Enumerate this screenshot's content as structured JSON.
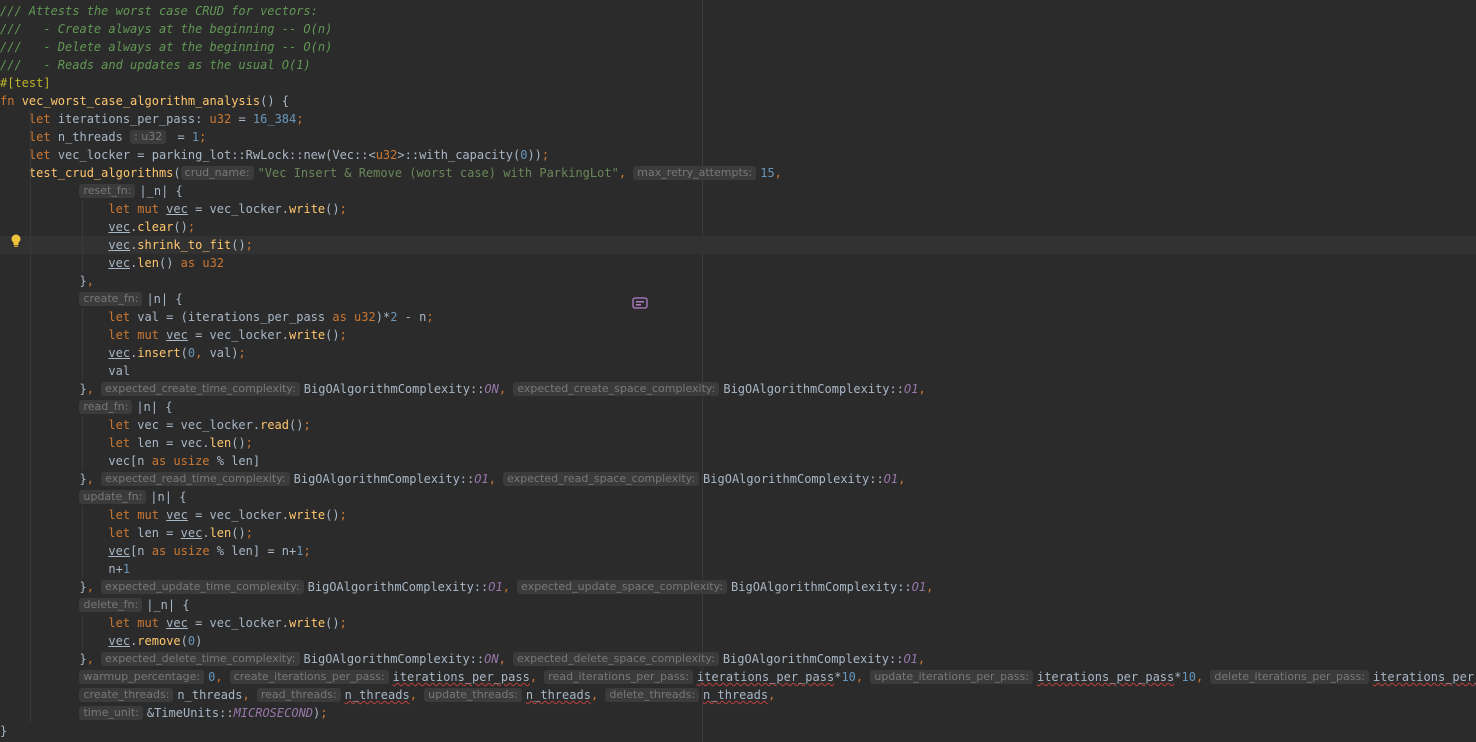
{
  "editor": {
    "lines": [
      [
        [
          "comment",
          "/// Attests the worst case CRUD for vectors:"
        ]
      ],
      [
        [
          "comment",
          "///   - Create always at the beginning -- O(n)"
        ]
      ],
      [
        [
          "comment",
          "///   - Delete always at the beginning -- O(n)"
        ]
      ],
      [
        [
          "comment",
          "///   - Reads and updates as the usual O(1)"
        ]
      ],
      [
        [
          "attr",
          "#[test]"
        ]
      ],
      [
        [
          "kw",
          "fn "
        ],
        [
          "fn",
          "vec_worst_case_algorithm_analysis"
        ],
        [
          "plain",
          "() {"
        ]
      ],
      [
        [
          "plain",
          "    "
        ],
        [
          "kw",
          "let "
        ],
        [
          "plain",
          "iterations_per_pass: "
        ],
        [
          "type",
          "u32"
        ],
        [
          "plain",
          " = "
        ],
        [
          "num",
          "16_384"
        ],
        [
          "kw",
          ";"
        ]
      ],
      [
        [
          "plain",
          "    "
        ],
        [
          "kw",
          "let "
        ],
        [
          "plain",
          "n_threads "
        ],
        [
          "hint",
          ": u32"
        ],
        [
          "plain",
          " = "
        ],
        [
          "num",
          "1"
        ],
        [
          "kw",
          ";"
        ]
      ],
      [
        [
          "plain",
          "    "
        ],
        [
          "kw",
          "let "
        ],
        [
          "plain",
          "vec_locker = parking_lot::RwLock::new(Vec::<"
        ],
        [
          "type",
          "u32"
        ],
        [
          "plain",
          ">::with_capacity("
        ],
        [
          "num",
          "0"
        ],
        [
          "plain",
          "))"
        ],
        [
          "kw",
          ";"
        ]
      ],
      [
        [
          "plain",
          "    "
        ],
        [
          "fn",
          "test_crud_algorithms"
        ],
        [
          "plain",
          "("
        ],
        [
          "hint",
          "crud_name:"
        ],
        [
          "str",
          "\"Vec Insert & Remove (worst case) with ParkingLot\""
        ],
        [
          "kw",
          ", "
        ],
        [
          "hint",
          "max_retry_attempts:"
        ],
        [
          "num",
          "15"
        ],
        [
          "kw",
          ","
        ]
      ],
      [
        [
          "plain",
          "           "
        ],
        [
          "hint",
          "reset_fn:"
        ],
        [
          "plain",
          "|_n| {"
        ]
      ],
      [
        [
          "plain",
          "               "
        ],
        [
          "kw",
          "let mut "
        ],
        [
          "mut",
          "vec"
        ],
        [
          "plain",
          " = vec_locker."
        ],
        [
          "fn",
          "write"
        ],
        [
          "plain",
          "()"
        ],
        [
          "kw",
          ";"
        ]
      ],
      [
        [
          "plain",
          "               "
        ],
        [
          "mut",
          "vec"
        ],
        [
          "plain",
          "."
        ],
        [
          "fn",
          "clear"
        ],
        [
          "plain",
          "()"
        ],
        [
          "kw",
          ";"
        ]
      ],
      [
        [
          "plain",
          "               "
        ],
        [
          "mut",
          "vec"
        ],
        [
          "plain",
          "."
        ],
        [
          "fn",
          "shrink_to_fit"
        ],
        [
          "plain",
          "()"
        ],
        [
          "kw",
          ";"
        ]
      ],
      [
        [
          "plain",
          "               "
        ],
        [
          "mut",
          "vec"
        ],
        [
          "plain",
          "."
        ],
        [
          "fn",
          "len"
        ],
        [
          "plain",
          "() "
        ],
        [
          "kw",
          "as "
        ],
        [
          "type",
          "u32"
        ]
      ],
      [
        [
          "plain",
          "           }"
        ],
        [
          "kw",
          ","
        ]
      ],
      [
        [
          "plain",
          "           "
        ],
        [
          "hint",
          "create_fn:"
        ],
        [
          "plain",
          "|n| {"
        ]
      ],
      [
        [
          "plain",
          "               "
        ],
        [
          "kw",
          "let "
        ],
        [
          "plain",
          "val = (iterations_per_pass "
        ],
        [
          "kw",
          "as "
        ],
        [
          "type",
          "u32"
        ],
        [
          "plain",
          ")*"
        ],
        [
          "num",
          "2"
        ],
        [
          "plain",
          " - n"
        ],
        [
          "kw",
          ";"
        ]
      ],
      [
        [
          "plain",
          "               "
        ],
        [
          "kw",
          "let mut "
        ],
        [
          "mut",
          "vec"
        ],
        [
          "plain",
          " = vec_locker."
        ],
        [
          "fn",
          "write"
        ],
        [
          "plain",
          "()"
        ],
        [
          "kw",
          ";"
        ]
      ],
      [
        [
          "plain",
          "               "
        ],
        [
          "mut",
          "vec"
        ],
        [
          "plain",
          "."
        ],
        [
          "fn",
          "insert"
        ],
        [
          "plain",
          "("
        ],
        [
          "num",
          "0"
        ],
        [
          "kw",
          ", "
        ],
        [
          "plain",
          "val)"
        ],
        [
          "kw",
          ";"
        ]
      ],
      [
        [
          "plain",
          "               val"
        ]
      ],
      [
        [
          "plain",
          "           }"
        ],
        [
          "kw",
          ", "
        ],
        [
          "hint",
          "expected_create_time_complexity:"
        ],
        [
          "plain",
          "BigOAlgorithmComplexity::"
        ],
        [
          "const",
          "ON"
        ],
        [
          "kw",
          ", "
        ],
        [
          "hint",
          "expected_create_space_complexity:"
        ],
        [
          "plain",
          "BigOAlgorithmComplexity::"
        ],
        [
          "const",
          "O1"
        ],
        [
          "kw",
          ","
        ]
      ],
      [
        [
          "plain",
          "           "
        ],
        [
          "hint",
          "read_fn:"
        ],
        [
          "plain",
          "|n| {"
        ]
      ],
      [
        [
          "plain",
          "               "
        ],
        [
          "kw",
          "let "
        ],
        [
          "plain",
          "vec = vec_locker."
        ],
        [
          "fn",
          "read"
        ],
        [
          "plain",
          "()"
        ],
        [
          "kw",
          ";"
        ]
      ],
      [
        [
          "plain",
          "               "
        ],
        [
          "kw",
          "let "
        ],
        [
          "plain",
          "len = vec."
        ],
        [
          "fn",
          "len"
        ],
        [
          "plain",
          "()"
        ],
        [
          "kw",
          ";"
        ]
      ],
      [
        [
          "plain",
          "               vec[n "
        ],
        [
          "kw",
          "as "
        ],
        [
          "type",
          "usize"
        ],
        [
          "plain",
          " % len]"
        ]
      ],
      [
        [
          "plain",
          "           }"
        ],
        [
          "kw",
          ", "
        ],
        [
          "hint",
          "expected_read_time_complexity:"
        ],
        [
          "plain",
          "BigOAlgorithmComplexity::"
        ],
        [
          "const",
          "O1"
        ],
        [
          "kw",
          ", "
        ],
        [
          "hint",
          "expected_read_space_complexity:"
        ],
        [
          "plain",
          "BigOAlgorithmComplexity::"
        ],
        [
          "const",
          "O1"
        ],
        [
          "kw",
          ","
        ]
      ],
      [
        [
          "plain",
          "           "
        ],
        [
          "hint",
          "update_fn:"
        ],
        [
          "plain",
          "|n| {"
        ]
      ],
      [
        [
          "plain",
          "               "
        ],
        [
          "kw",
          "let mut "
        ],
        [
          "mut",
          "vec"
        ],
        [
          "plain",
          " = vec_locker."
        ],
        [
          "fn",
          "write"
        ],
        [
          "plain",
          "()"
        ],
        [
          "kw",
          ";"
        ]
      ],
      [
        [
          "plain",
          "               "
        ],
        [
          "kw",
          "let "
        ],
        [
          "plain",
          "len = "
        ],
        [
          "mut",
          "vec"
        ],
        [
          "plain",
          "."
        ],
        [
          "fn",
          "len"
        ],
        [
          "plain",
          "()"
        ],
        [
          "kw",
          ";"
        ]
      ],
      [
        [
          "plain",
          "               "
        ],
        [
          "mut",
          "vec"
        ],
        [
          "plain",
          "[n "
        ],
        [
          "kw",
          "as "
        ],
        [
          "type",
          "usize"
        ],
        [
          "plain",
          " % len] = n+"
        ],
        [
          "num",
          "1"
        ],
        [
          "kw",
          ";"
        ]
      ],
      [
        [
          "plain",
          "               n+"
        ],
        [
          "num",
          "1"
        ]
      ],
      [
        [
          "plain",
          "           }"
        ],
        [
          "kw",
          ", "
        ],
        [
          "hint",
          "expected_update_time_complexity:"
        ],
        [
          "plain",
          "BigOAlgorithmComplexity::"
        ],
        [
          "const",
          "O1"
        ],
        [
          "kw",
          ", "
        ],
        [
          "hint",
          "expected_update_space_complexity:"
        ],
        [
          "plain",
          "BigOAlgorithmComplexity::"
        ],
        [
          "const",
          "O1"
        ],
        [
          "kw",
          ","
        ]
      ],
      [
        [
          "plain",
          "           "
        ],
        [
          "hint",
          "delete_fn:"
        ],
        [
          "plain",
          "|_n| {"
        ]
      ],
      [
        [
          "plain",
          "               "
        ],
        [
          "kw",
          "let mut "
        ],
        [
          "mut",
          "vec"
        ],
        [
          "plain",
          " = vec_locker."
        ],
        [
          "fn",
          "write"
        ],
        [
          "plain",
          "()"
        ],
        [
          "kw",
          ";"
        ]
      ],
      [
        [
          "plain",
          "               "
        ],
        [
          "mut",
          "vec"
        ],
        [
          "plain",
          "."
        ],
        [
          "fn",
          "remove"
        ],
        [
          "plain",
          "("
        ],
        [
          "num",
          "0"
        ],
        [
          "plain",
          ")"
        ]
      ],
      [
        [
          "plain",
          "           }"
        ],
        [
          "kw",
          ", "
        ],
        [
          "hint",
          "expected_delete_time_complexity:"
        ],
        [
          "plain",
          "BigOAlgorithmComplexity::"
        ],
        [
          "const",
          "ON"
        ],
        [
          "kw",
          ", "
        ],
        [
          "hint",
          "expected_delete_space_complexity:"
        ],
        [
          "plain",
          "BigOAlgorithmComplexity::"
        ],
        [
          "const",
          "O1"
        ],
        [
          "kw",
          ","
        ]
      ],
      [
        [
          "plain",
          "           "
        ],
        [
          "hint",
          "warmup_percentage:"
        ],
        [
          "num",
          "0"
        ],
        [
          "kw",
          ", "
        ],
        [
          "hint",
          "create_iterations_per_pass:"
        ],
        [
          "sq",
          "iterations_per_pass"
        ],
        [
          "kw",
          ", "
        ],
        [
          "hint",
          "read_iterations_per_pass:"
        ],
        [
          "sq",
          "iterations_per_pass"
        ],
        [
          "plain",
          "*"
        ],
        [
          "num",
          "10"
        ],
        [
          "kw",
          ", "
        ],
        [
          "hint",
          "update_iterations_per_pass:"
        ],
        [
          "sq",
          "iterations_per_pass"
        ],
        [
          "plain",
          "*"
        ],
        [
          "num",
          "10"
        ],
        [
          "kw",
          ", "
        ],
        [
          "hint",
          "delete_iterations_per_pass:"
        ],
        [
          "sq",
          "iterations_per_pass"
        ],
        [
          "kw",
          ","
        ]
      ],
      [
        [
          "plain",
          "           "
        ],
        [
          "hint",
          "create_threads:"
        ],
        [
          "plain",
          "n_threads"
        ],
        [
          "kw",
          ", "
        ],
        [
          "hint",
          "read_threads:"
        ],
        [
          "sq",
          "n_threads"
        ],
        [
          "kw",
          ", "
        ],
        [
          "hint",
          "update_threads:"
        ],
        [
          "sq",
          "n_threads"
        ],
        [
          "kw",
          ", "
        ],
        [
          "hint",
          "delete_threads:"
        ],
        [
          "sq",
          "n_threads"
        ],
        [
          "kw",
          ","
        ]
      ],
      [
        [
          "plain",
          "           "
        ],
        [
          "hint",
          "time_unit:"
        ],
        [
          "plain",
          "&TimeUnits::"
        ],
        [
          "const",
          "MICROSECOND"
        ],
        [
          "plain",
          ")"
        ],
        [
          "kw",
          ";"
        ]
      ],
      [
        [
          "plain",
          "}"
        ]
      ]
    ],
    "current_line": 13,
    "icons": {
      "intention": "lightbulb-icon",
      "format": "format-icon"
    }
  }
}
